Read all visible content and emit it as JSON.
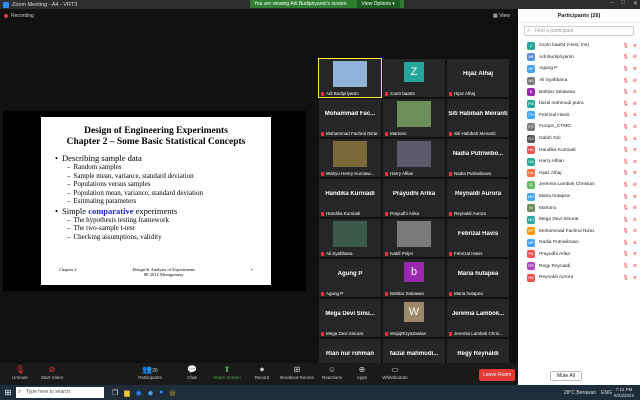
{
  "window": {
    "title": "Zoom Meeting - A4 - VRT3"
  },
  "banner": {
    "viewing": "You are viewing Adi Budipriyanto's screen",
    "view_options": "View Options ▾"
  },
  "recording": "Recording",
  "view_btn": "View",
  "slide": {
    "title1": "Design of Engineering Experiments",
    "title2": "Chapter 2 – Some Basic Statistical Concepts",
    "b1": "Describing sample data",
    "s1": [
      "Random samples",
      "Sample mean, variance, standard deviation",
      "Populations versus samples",
      "Population mean, variance, standard deviation",
      "Estimating parameters"
    ],
    "b2_pre": "Simple ",
    "b2_hl": "comparative",
    "b2_post": " experiments",
    "s2": [
      "The hypothesis testing framework",
      "The two-sample t-test",
      "Checking assumptions, validity"
    ],
    "foot_left": "Chapter 2",
    "foot_mid1": "Design & Analysis of Experiments",
    "foot_mid2": "8E 2012 Montgomery",
    "foot_right": "1"
  },
  "tiles": [
    {
      "name": "Adi Budipriyanto",
      "kind": "photo",
      "color": "#8fb3d9"
    },
    {
      "name": "zoom baa04",
      "kind": "avatar",
      "letter": "Z",
      "color": "#26a69a"
    },
    {
      "name": "Hijaz Alhaj",
      "kind": "text"
    },
    {
      "name": "Mohammad Fachrul Nizar",
      "kind": "text",
      "big": "Mohammad Fac..."
    },
    {
      "name": "Martono",
      "kind": "photo",
      "color": "#6d8f5a"
    },
    {
      "name": "Siti Habibah Meiranti",
      "kind": "text"
    },
    {
      "name": "Wahyu Henry Kurniaw...",
      "kind": "photo",
      "color": "#7a6a3a"
    },
    {
      "name": "Harry Alfian",
      "kind": "photo",
      "color": "#5a5a6a"
    },
    {
      "name": "Nadia Putriwibowo",
      "kind": "text",
      "big": "Nadia Putriwibo..."
    },
    {
      "name": "Handika Kurniadi",
      "kind": "text"
    },
    {
      "name": "Prayudhi Arika",
      "kind": "text"
    },
    {
      "name": "Reynaldi Aurora",
      "kind": "text"
    },
    {
      "name": "Ali Syahbana",
      "kind": "photo",
      "color": "#3c5a4a"
    },
    {
      "name": "Ivaldi Poljer",
      "kind": "photo",
      "color": "#7a7a7a"
    },
    {
      "name": "Febrizal Havis",
      "kind": "text"
    },
    {
      "name": "Agung P",
      "kind": "text"
    },
    {
      "name": "Bahtiar Setiawan",
      "kind": "avatar",
      "letter": "b",
      "color": "#9c27b0"
    },
    {
      "name": "Maria hutapea",
      "kind": "text"
    },
    {
      "name": "Mega Devi Sinurat",
      "kind": "text",
      "big": "Mega Devi Sinu..."
    },
    {
      "name": "WajiqRizyaZaelan",
      "kind": "avatar",
      "letter": "W",
      "color": "#9e8a6a"
    },
    {
      "name": "Jeremia Lambok Chris...",
      "kind": "text",
      "big": "Jeremia Lambok..."
    },
    {
      "name": "Rian nur rohman",
      "kind": "text"
    },
    {
      "name": "faizal mahmudi putra",
      "kind": "text",
      "big": "faizal mahmudi..."
    },
    {
      "name": "Regy Reynaldi",
      "kind": "text"
    }
  ],
  "toolbar": {
    "unmute": "Unmute",
    "start_video": "Start Video",
    "participants": "Participants",
    "participants_count": "26",
    "chat": "Chat",
    "share": "Share Screen",
    "record": "Record",
    "breakout": "Breakout Rooms",
    "reactions": "Reactions",
    "apps": "Apps",
    "whiteboards": "Whiteboards",
    "leave": "Leave Room"
  },
  "panel": {
    "title": "Participants (26)",
    "search_placeholder": "Find a participant",
    "mute_all": "Mute All",
    "participants": [
      {
        "initials": "Z",
        "name": "zoom baa04 (Host, me)",
        "color": "#26a69a"
      },
      {
        "initials": "AB",
        "name": "Adi Budipriyanto",
        "color": "#5c8fd6"
      },
      {
        "initials": "AP",
        "name": "Agung P",
        "color": "#42a5f5"
      },
      {
        "initials": "AS",
        "name": "Ali Syahbana",
        "color": "#7a7a7a"
      },
      {
        "initials": "B",
        "name": "Bahtiar Setiawan",
        "color": "#9c27b0"
      },
      {
        "initials": "FM",
        "name": "faizal mahmudi putra",
        "color": "#26a69a"
      },
      {
        "initials": "FH",
        "name": "Febrizal Havis",
        "color": "#42a5f5"
      },
      {
        "initials": "FC",
        "name": "Furqon_CTMG",
        "color": "#7a7a7a"
      },
      {
        "initials": "GS",
        "name": "Galoh Giri",
        "color": "#555555"
      },
      {
        "initials": "HK",
        "name": "Handika Kurniadi",
        "color": "#ef5350"
      },
      {
        "initials": "HA",
        "name": "Harry Alfian",
        "color": "#26a69a"
      },
      {
        "initials": "HA",
        "name": "Hijaz Alhaj",
        "color": "#ff7043"
      },
      {
        "initials": "JL",
        "name": "Jeremia Lambok Christian",
        "color": "#66bb6a"
      },
      {
        "initials": "MH",
        "name": "Maria hutapea",
        "color": "#42a5f5"
      },
      {
        "initials": "M",
        "name": "Martono",
        "color": "#6d8f5a"
      },
      {
        "initials": "MD",
        "name": "Mega Devi Sinurat",
        "color": "#26a69a"
      },
      {
        "initials": "MF",
        "name": "Mohammad Fachrul Nizar",
        "color": "#ff9800"
      },
      {
        "initials": "NP",
        "name": "Nadia Putriwibowo",
        "color": "#42a5f5"
      },
      {
        "initials": "PA",
        "name": "Prayudhi Arika",
        "color": "#ef5350"
      },
      {
        "initials": "RR",
        "name": "Regy Reynaldi",
        "color": "#ab47bc"
      },
      {
        "initials": "RA",
        "name": "Reynaldi Aurora",
        "color": "#ef5350"
      }
    ]
  },
  "taskbar": {
    "search": "Type here to search",
    "weather": "28°C Berawan",
    "lang": "ENG",
    "time": "7:12 PM",
    "date": "9/23/2022"
  }
}
